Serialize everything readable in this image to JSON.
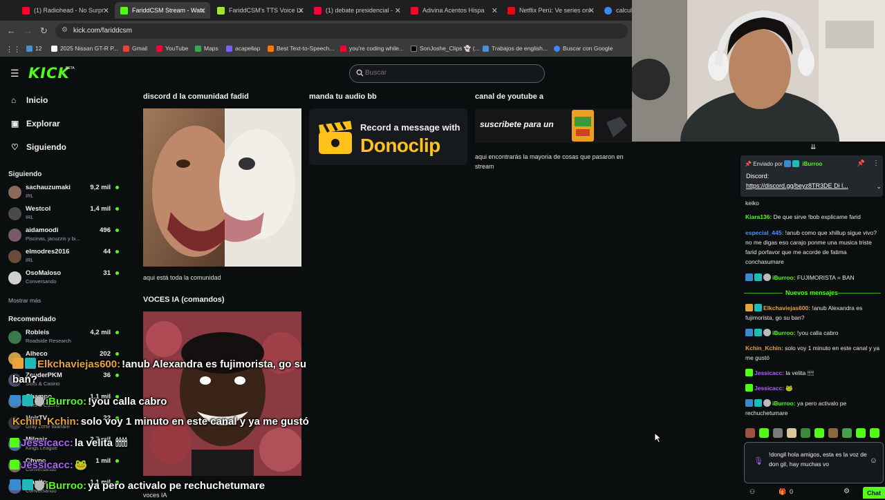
{
  "browser": {
    "tabs": [
      {
        "title": "(1) Radiohead - No Surpr",
        "color": "#ff0033"
      },
      {
        "title": "FariddCSM Stream - Watc",
        "color": "#53fc18"
      },
      {
        "title": "FariddCSM's TTS Voice Li",
        "color": "#a6e22e"
      },
      {
        "title": "(1) debate presidencial - ",
        "color": "#ff0033"
      },
      {
        "title": "Adivina Acentos Hispa",
        "color": "#ff0033"
      },
      {
        "title": "Netflix Perú: Ve series onl",
        "color": "#e50914"
      },
      {
        "title": "calcula",
        "color": "#4285f4"
      }
    ],
    "url": "kick.com/fariddcsm",
    "bookmarks": [
      {
        "label": "12",
        "color": "#4a90d9"
      },
      {
        "label": "2025 Nissan GT-R P...",
        "color": "#ffffff"
      },
      {
        "label": "Gmail",
        "color": "#ea4335"
      },
      {
        "label": "YouTube",
        "color": "#ff0033"
      },
      {
        "label": "Maps",
        "color": "#34a853"
      },
      {
        "label": "acapellap",
        "color": "#7b61ff"
      },
      {
        "label": "Best Text-to-Speech...",
        "color": "#ff7a00"
      },
      {
        "label": "you're coding while...",
        "color": "#ff0033"
      },
      {
        "label": "SonJoshe_Clips 👻 (...",
        "color": "#000000"
      },
      {
        "label": "Trabajos de english...",
        "color": "#4a90d9"
      },
      {
        "label": "Buscar con Google",
        "color": "#4285f4"
      }
    ]
  },
  "kick": {
    "logo": "KICK",
    "beta": "BETA",
    "search_placeholder": "Buscar",
    "nav": [
      {
        "label": "Inicio",
        "icon": "home-icon"
      },
      {
        "label": "Explorar",
        "icon": "compass-icon"
      },
      {
        "label": "Siguiendo",
        "icon": "heart-icon"
      }
    ],
    "following_title": "Siguiendo",
    "following": [
      {
        "name": "sachauzumaki",
        "category": "IRL",
        "viewers": "9,2 mil",
        "color": "#8a6a5a"
      },
      {
        "name": "Westcol",
        "category": "IRL",
        "viewers": "1,4 mil",
        "color": "#4a4a4a"
      },
      {
        "name": "aidamoodi",
        "category": "Piscinas, jacuzzis y bi...",
        "viewers": "496",
        "color": "#7a5a6a"
      },
      {
        "name": "elmodres2016",
        "category": "IRL",
        "viewers": "44",
        "color": "#6a4a3a"
      },
      {
        "name": "OsoMaloso",
        "category": "Conversando",
        "viewers": "31",
        "color": "#d0d0d0"
      }
    ],
    "show_more": "Mostrar más",
    "recommended_title": "Recomendado",
    "recommended": [
      {
        "name": "Robleis",
        "category": "Roadside Research",
        "viewers": "4,2 mil",
        "color": "#3a7a4a"
      },
      {
        "name": "Alheco",
        "category": "Slots & Casino",
        "viewers": "202",
        "color": "#c8a040"
      },
      {
        "name": "ZeuderPKM",
        "category": "Slots & Casino",
        "viewers": "36",
        "color": "#505070"
      },
      {
        "name": "Champo",
        "category": "Slots & Casino",
        "viewers": "1,1 mil",
        "color": "#5a6a7a"
      },
      {
        "name": "NoirTV",
        "category": "Gray Zone Warfare",
        "viewers": "22",
        "color": "#3a3a3a"
      },
      {
        "name": "Milgaiz",
        "category": "Kings League",
        "viewers": "2,7 mil",
        "color": "#4a6a9a"
      },
      {
        "name": "Chyno",
        "category": "Conversando",
        "viewers": "1 mil",
        "color": "#7a6a5a"
      },
      {
        "name": "Manito",
        "category": "Conversando",
        "viewers": "1,1 mil",
        "color": "#5a5a8a"
      }
    ],
    "panels": [
      {
        "title": "discord d la comunidad fadid",
        "desc": "aqui está toda la comunidad"
      },
      {
        "title": "manda tu audio bb",
        "banner_title": "Record a message with",
        "banner_brand": "Donoclip"
      },
      {
        "title": "canal de youtube a",
        "banner": "suscribete para un",
        "desc": "aqui encontrarás la mayoria de cosas que pasaron en stream"
      },
      {
        "title": "VOCES IA (comandos)",
        "desc": "voces IA"
      }
    ]
  },
  "overlay_chat": [
    {
      "user": "Elkchaviejas600:",
      "text": "!anub Alexandra es fujimorista, go su",
      "cont": "ban?",
      "color": "#e8a33a"
    },
    {
      "user": "iBurroo:",
      "text": "!you calla cabro",
      "color": "#53fc18"
    },
    {
      "user": "Kchin_Kchin:",
      "text": "solo voy 1 minuto en este canal y ya me gustó",
      "color": "#e8a33a"
    },
    {
      "user": "Jessicacc:",
      "text": "la velita 🕯🕯🕯🕯",
      "color": "#b060ff"
    },
    {
      "user": "Jessicacc:",
      "text": "🐸",
      "color": "#b060ff"
    },
    {
      "user": "iBurroo:",
      "text": "ya pero activalo pe rechuchetumare",
      "color": "#53fc18"
    }
  ],
  "chat": {
    "pinned": {
      "by_label": "Enviado por",
      "by_user": "iBurroo",
      "discord_label": "Discord:",
      "link": "https://discord.gg/beyz8TR3DE",
      "link_suffix": "Di l..."
    },
    "messages": [
      {
        "user": "",
        "text": "keiko",
        "color": "#e8e8e8"
      },
      {
        "user": "Kiara136:",
        "text": " De que sirve !bob explicame farid",
        "color": "#53fc18"
      },
      {
        "user": "especial_445:",
        "text": " !anub como que xhillup sigue vivo? no me digas eso carajo ponme una musica triste farid porfavor que me acorde de fatima conchasumare",
        "color": "#4a90ff"
      },
      {
        "user": "iBurroo:",
        "text": " FUJIMORISTA = BAN",
        "color": "#53fc18"
      }
    ],
    "new_messages_label": "Nuevos mensajes",
    "new_messages": [
      {
        "user": "Elkchaviejas600:",
        "text": " !anub Alexandra es fujimorista, go su ban?",
        "color": "#e8a33a"
      },
      {
        "user": "iBurroo:",
        "text": " !you calla cabro",
        "color": "#53fc18"
      },
      {
        "user": "Kchin_Kchin:",
        "text": " solo voy 1 minuto en este canal y ya me gustó",
        "color": "#e8a33a"
      },
      {
        "user": "Jessicacc:",
        "text": " la velita 🕯🕯🕯🕯",
        "color": "#b060ff"
      },
      {
        "user": "Jessicacc:",
        "text": " 🐸",
        "color": "#b060ff"
      },
      {
        "user": "iBurroo:",
        "text": " ya pero activalo pe rechuchetumare",
        "color": "#53fc18"
      }
    ],
    "input_text": "!dongil hola amigos, esta es la voz de don gil, hay muchas vo",
    "footer_count": "0",
    "send_label": "Chat"
  }
}
